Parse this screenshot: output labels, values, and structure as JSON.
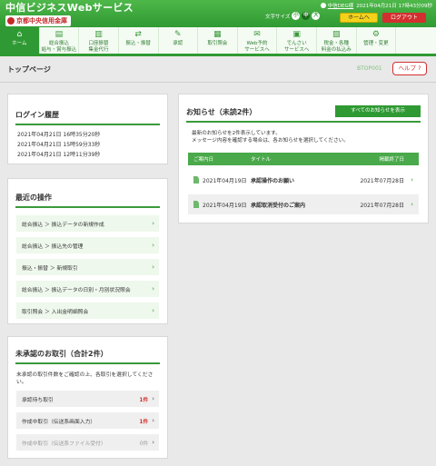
{
  "header": {
    "brand_title": "中信ビジネスWebサービス",
    "brand_sub": "京都中央信用金庫",
    "user_name": "中信DEG様",
    "last_login_text": "2021年04月21日 17時43分09秒",
    "font_size_label": "文字サイズ",
    "font_sizes": [
      "小",
      "中",
      "大"
    ],
    "home_label": "ホームへ",
    "logout_label": "ログアウト",
    "colors": {
      "brand_green": "#2f9a33",
      "home_yellow": "#f4d21c",
      "logout_red": "#d32f2f"
    }
  },
  "nav": {
    "items": [
      {
        "label": "ホーム",
        "icon": "home-icon",
        "glyph": "⌂",
        "active": true
      },
      {
        "label": "総合振込\n給与・賞与振込",
        "icon": "transfer-icon",
        "glyph": "▤",
        "active": false
      },
      {
        "label": "口座振替\n集金代行",
        "icon": "debit-icon",
        "glyph": "▥",
        "active": false
      },
      {
        "label": "振込・振替",
        "icon": "exchange-icon",
        "glyph": "⇄",
        "active": false
      },
      {
        "label": "承認",
        "icon": "approve-icon",
        "glyph": "✎",
        "active": false
      },
      {
        "label": "取引照会",
        "icon": "inquiry-icon",
        "glyph": "▦",
        "active": false
      },
      {
        "label": "Web予約\nサービスへ",
        "icon": "web-reserve-icon",
        "glyph": "✉",
        "active": false
      },
      {
        "label": "でんさい\nサービスへ",
        "icon": "densai-icon",
        "glyph": "▣",
        "active": false
      },
      {
        "label": "税金・各種\n料金の払込み",
        "icon": "tax-icon",
        "glyph": "▧",
        "active": false
      },
      {
        "label": "管理・変更",
        "icon": "settings-icon",
        "glyph": "⚙",
        "active": false
      }
    ]
  },
  "page": {
    "title": "トップページ",
    "screen_id": "BTOP001",
    "help_label": "ヘルプ"
  },
  "login_history": {
    "title": "ログイン履歴",
    "entries": [
      "2021年04月21日 16時35分20秒",
      "2021年04月21日 15時59分33秒",
      "2021年04月21日 12時11分39秒"
    ]
  },
  "recent_ops": {
    "title": "最近の操作",
    "items": [
      "総合振込 ＞ 振込データの新規作成",
      "総合振込 ＞ 振込先の管理",
      "振込・振替 ＞ 新規取引",
      "総合振込 ＞ 振込データの日別・月別状況照会",
      "取引照会 ＞ 入出金明細照会"
    ]
  },
  "unapproved": {
    "title": "未承認のお取引（合計2件）",
    "description": "未承認の取引件数をご確認の上、各取引を選択してください。",
    "items": [
      {
        "label": "承認待ち取引",
        "count": "1件",
        "dim": false
      },
      {
        "label": "作成中取引（伝送系画面入力）",
        "count": "1件",
        "dim": false
      },
      {
        "label": "作成中取引（伝送系ファイル受付）",
        "count": "0件",
        "dim": true
      }
    ]
  },
  "notices": {
    "title": "お知らせ（未読2件）",
    "all_button": "すべてのお知らせを表示",
    "description": "最新のお知らせを2件表示しています。\nメッセージ内容を確認する場合は、各お知らせを選択してください。",
    "columns": {
      "date": "ご案内日",
      "title": "タイトル",
      "due": "掲載終了日"
    },
    "rows": [
      {
        "date": "2021年04月19日",
        "title": "承認操作のお願い",
        "due": "2021年07月28日"
      },
      {
        "date": "2021年04月19日",
        "title": "承認取消受付のご案内",
        "due": "2021年07月28日"
      }
    ]
  }
}
